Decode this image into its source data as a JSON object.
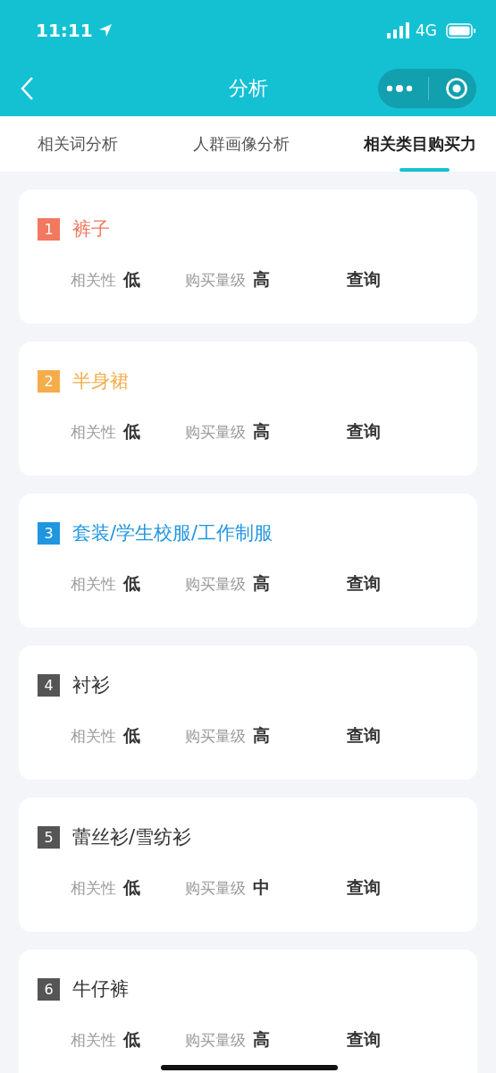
{
  "status_bar": {
    "time": "11:11",
    "network": "4G"
  },
  "nav": {
    "title": "分析"
  },
  "tabs": [
    {
      "label": "相关词分析",
      "selected": false
    },
    {
      "label": "人群画像分析",
      "selected": false
    },
    {
      "label": "相关类目购买力",
      "selected": true
    }
  ],
  "items": [
    {
      "rank": "1",
      "name": "裤子",
      "color": "#f0795f",
      "relevance_label": "相关性",
      "relevance": "低",
      "volume_label": "购买量级",
      "volume": "高",
      "action": "查询"
    },
    {
      "rank": "2",
      "name": "半身裙",
      "color": "#f5ad4c",
      "relevance_label": "相关性",
      "relevance": "低",
      "volume_label": "购买量级",
      "volume": "高",
      "action": "查询"
    },
    {
      "rank": "3",
      "name": "套装/学生校服/工作制服",
      "color": "#2196e0",
      "relevance_label": "相关性",
      "relevance": "低",
      "volume_label": "购买量级",
      "volume": "高",
      "action": "查询"
    },
    {
      "rank": "4",
      "name": "衬衫",
      "color": "#555555",
      "relevance_label": "相关性",
      "relevance": "低",
      "volume_label": "购买量级",
      "volume": "高",
      "action": "查询"
    },
    {
      "rank": "5",
      "name": "蕾丝衫/雪纺衫",
      "color": "#555555",
      "relevance_label": "相关性",
      "relevance": "低",
      "volume_label": "购买量级",
      "volume": "中",
      "action": "查询"
    },
    {
      "rank": "6",
      "name": "牛仔裤",
      "color": "#555555",
      "relevance_label": "相关性",
      "relevance": "低",
      "volume_label": "购买量级",
      "volume": "高",
      "action": "查询"
    }
  ]
}
